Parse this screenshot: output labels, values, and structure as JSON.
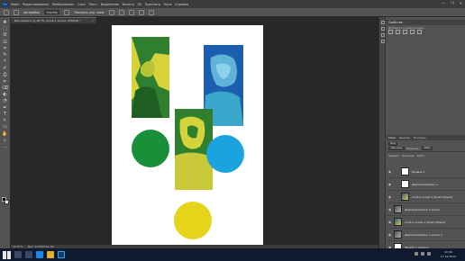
{
  "menubar": {
    "logo": "Ps",
    "items": [
      "Файл",
      "Редактирование",
      "Изображение",
      "Слои",
      "Текст",
      "Выделение",
      "Фильтр",
      "3D",
      "Просмотр",
      "Окно",
      "Справка"
    ],
    "window_controls": [
      "—",
      "❐",
      "✕"
    ]
  },
  "options_bar": {
    "auto_select_label": "Автовыбор",
    "layer_value": "Группа",
    "transform_label": "Показать упр. элем."
  },
  "document_tab": {
    "title": "Без имени-1 @ 16,7% (Слой 1 копия, CMYK/8) *",
    "close": "×"
  },
  "tools": [
    "✥",
    "⬚",
    "ʘ",
    "⊡",
    "⌗",
    "✎",
    "⚕",
    "✐",
    "⎙",
    "⦵",
    "⌫",
    "◐",
    "◔",
    "✒",
    "T",
    "↖",
    "▭",
    "✋",
    "⌕",
    "…"
  ],
  "properties": {
    "title": "Свойства",
    "subtitle": "Добавить корректировку"
  },
  "layers_panel": {
    "tabs": [
      "Слои",
      "Каналы",
      "Контуры"
    ],
    "kind_filter": "Вид",
    "blend_mode": "Обычные",
    "opacity_label": "Непрозр.:",
    "opacity_value": "100%",
    "lock_label": "Закреп.:",
    "fill_label": "Заливка:",
    "fill_value": "100%",
    "layers": [
      {
        "name": "Кривые 1",
        "thumb": "white",
        "indent": true,
        "underline": false,
        "selected": false
      },
      {
        "name": "Цветовой баланс 1",
        "thumb": "white",
        "indent": true,
        "underline": false,
        "selected": false
      },
      {
        "name": "Слой 1 копия 3 (Smart Object)",
        "thumb": "photo",
        "indent": true,
        "underline": false,
        "selected": false
      },
      {
        "name": "Цветовой баланс 1 копия",
        "thumb": "fx",
        "indent": false,
        "underline": true,
        "selected": false
      },
      {
        "name": "Слой 1 копия 2 (Smart Object)",
        "thumb": "photo",
        "indent": false,
        "underline": false,
        "selected": false
      },
      {
        "name": "Цветовой баланс 1 копия 2",
        "thumb": "fx",
        "indent": false,
        "underline": true,
        "selected": false
      },
      {
        "name": "Эллипс 1 копия 2",
        "thumb": "white",
        "indent": false,
        "underline": false,
        "selected": false
      },
      {
        "name": "Эллипс 1 копия",
        "thumb": "white",
        "indent": false,
        "underline": false,
        "selected": true
      }
    ]
  },
  "status_bar": {
    "zoom": "16,67%",
    "doc_info": "Док: 24,9M/144,1M"
  },
  "canvas": {
    "colors": {
      "green_circle": "#1a8f3a",
      "blue_circle": "#1aa3de",
      "yellow_circle": "#e6d41a",
      "duotone_green": "#2f7f2e",
      "duotone_yellow": "#d4d43a",
      "duotone_blue": "#1c5fb0",
      "duotone_cyan": "#3aa6c9"
    }
  },
  "taskbar": {
    "time": "22:06",
    "date": "17.10.2019"
  }
}
